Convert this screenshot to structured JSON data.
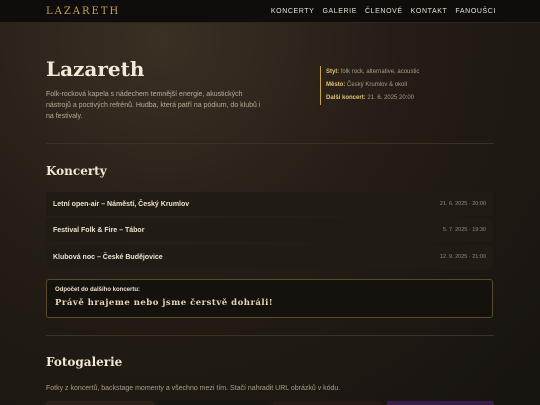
{
  "nav": {
    "logo": "LAZARETH",
    "items": [
      "KONCERTY",
      "GALERIE",
      "ČLENOVÉ",
      "KONTAKT",
      "FANOUŠCI"
    ]
  },
  "hero": {
    "title": "Lazareth",
    "description": "Folk-rocková kapela s nádechem temnější energie, akustických nástrojů a poctivých refrénů. Hudba, která patří na pódium, do klubů i na festivaly."
  },
  "info": {
    "style_label": "Styl:",
    "style_value": "folk rock, alternative, acoustic",
    "city_label": "Město:",
    "city_value": "Český Krumlov & okolí",
    "next_label": "Další koncert:",
    "next_value": "21. 6. 2025 20:00"
  },
  "concerts": {
    "heading": "Koncerty",
    "items": [
      {
        "name": "Letní open-air – Náměstí, Český Krumlov",
        "date": "21. 6. 2025 · 20:00"
      },
      {
        "name": "Festival Folk & Fire – Tábor",
        "date": "5. 7. 2025 · 19:30"
      },
      {
        "name": "Klubová noc – České Budějovice",
        "date": "12. 9. 2025 · 21:00"
      }
    ]
  },
  "countdown": {
    "label": "Odpočet do dalšího koncertu:",
    "message": "Právě hrajeme nebo jsme čerstvě dohráli!"
  },
  "gallery": {
    "heading": "Fotogalerie",
    "description": "Fotky z koncertů, backstage momenty a všechno mezi tím. Stačí nahradit URL obrázků v kódu."
  },
  "colors": {
    "accent": "#c9a14a",
    "background": "#1d1812"
  }
}
